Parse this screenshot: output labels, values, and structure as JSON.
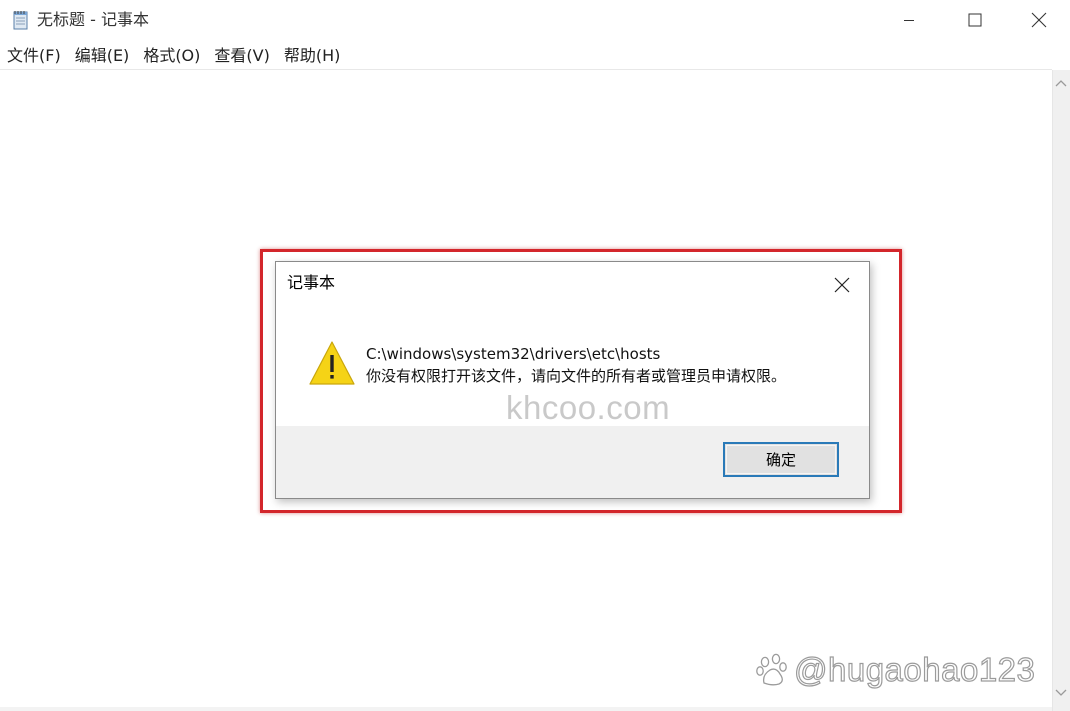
{
  "window": {
    "title": "无标题 - 记事本",
    "icon": "notepad-icon",
    "controls": [
      "minimize-icon",
      "maximize-icon",
      "close-icon"
    ]
  },
  "menu": {
    "items": [
      {
        "label": "文件(F)"
      },
      {
        "label": "编辑(E)"
      },
      {
        "label": "格式(O)"
      },
      {
        "label": "查看(V)"
      },
      {
        "label": "帮助(H)"
      }
    ]
  },
  "dialog": {
    "title": "记事本",
    "icon": "warning-icon",
    "path": "C:\\windows\\system32\\drivers\\etc\\hosts",
    "message": "你没有权限打开该文件，请向文件的所有者或管理员申请权限。",
    "ok_label": "确定"
  },
  "watermarks": {
    "center": "khcoo.com",
    "corner": "@hugaohao123",
    "corner_logo": "baidu-paw-icon"
  },
  "colors": {
    "highlight": "#d3262b",
    "button_border": "#2a7ab8",
    "warning": "#f5d316"
  }
}
